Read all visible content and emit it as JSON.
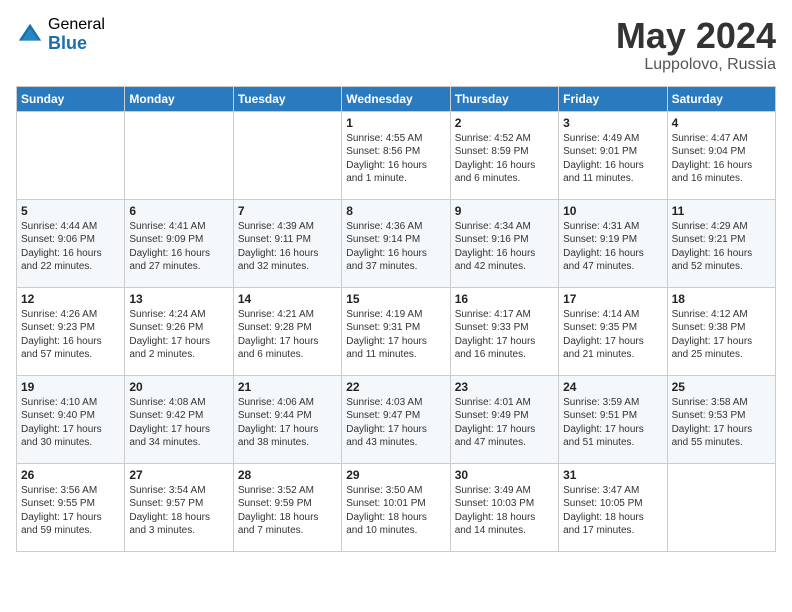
{
  "header": {
    "logo_general": "General",
    "logo_blue": "Blue",
    "month_year": "May 2024",
    "location": "Luppolovo, Russia"
  },
  "days_of_week": [
    "Sunday",
    "Monday",
    "Tuesday",
    "Wednesday",
    "Thursday",
    "Friday",
    "Saturday"
  ],
  "weeks": [
    [
      {
        "day": "",
        "sunrise": "",
        "sunset": "",
        "daylight": ""
      },
      {
        "day": "",
        "sunrise": "",
        "sunset": "",
        "daylight": ""
      },
      {
        "day": "",
        "sunrise": "",
        "sunset": "",
        "daylight": ""
      },
      {
        "day": "1",
        "sunrise": "Sunrise: 4:55 AM",
        "sunset": "Sunset: 8:56 PM",
        "daylight": "Daylight: 16 hours and 1 minute."
      },
      {
        "day": "2",
        "sunrise": "Sunrise: 4:52 AM",
        "sunset": "Sunset: 8:59 PM",
        "daylight": "Daylight: 16 hours and 6 minutes."
      },
      {
        "day": "3",
        "sunrise": "Sunrise: 4:49 AM",
        "sunset": "Sunset: 9:01 PM",
        "daylight": "Daylight: 16 hours and 11 minutes."
      },
      {
        "day": "4",
        "sunrise": "Sunrise: 4:47 AM",
        "sunset": "Sunset: 9:04 PM",
        "daylight": "Daylight: 16 hours and 16 minutes."
      }
    ],
    [
      {
        "day": "5",
        "sunrise": "Sunrise: 4:44 AM",
        "sunset": "Sunset: 9:06 PM",
        "daylight": "Daylight: 16 hours and 22 minutes."
      },
      {
        "day": "6",
        "sunrise": "Sunrise: 4:41 AM",
        "sunset": "Sunset: 9:09 PM",
        "daylight": "Daylight: 16 hours and 27 minutes."
      },
      {
        "day": "7",
        "sunrise": "Sunrise: 4:39 AM",
        "sunset": "Sunset: 9:11 PM",
        "daylight": "Daylight: 16 hours and 32 minutes."
      },
      {
        "day": "8",
        "sunrise": "Sunrise: 4:36 AM",
        "sunset": "Sunset: 9:14 PM",
        "daylight": "Daylight: 16 hours and 37 minutes."
      },
      {
        "day": "9",
        "sunrise": "Sunrise: 4:34 AM",
        "sunset": "Sunset: 9:16 PM",
        "daylight": "Daylight: 16 hours and 42 minutes."
      },
      {
        "day": "10",
        "sunrise": "Sunrise: 4:31 AM",
        "sunset": "Sunset: 9:19 PM",
        "daylight": "Daylight: 16 hours and 47 minutes."
      },
      {
        "day": "11",
        "sunrise": "Sunrise: 4:29 AM",
        "sunset": "Sunset: 9:21 PM",
        "daylight": "Daylight: 16 hours and 52 minutes."
      }
    ],
    [
      {
        "day": "12",
        "sunrise": "Sunrise: 4:26 AM",
        "sunset": "Sunset: 9:23 PM",
        "daylight": "Daylight: 16 hours and 57 minutes."
      },
      {
        "day": "13",
        "sunrise": "Sunrise: 4:24 AM",
        "sunset": "Sunset: 9:26 PM",
        "daylight": "Daylight: 17 hours and 2 minutes."
      },
      {
        "day": "14",
        "sunrise": "Sunrise: 4:21 AM",
        "sunset": "Sunset: 9:28 PM",
        "daylight": "Daylight: 17 hours and 6 minutes."
      },
      {
        "day": "15",
        "sunrise": "Sunrise: 4:19 AM",
        "sunset": "Sunset: 9:31 PM",
        "daylight": "Daylight: 17 hours and 11 minutes."
      },
      {
        "day": "16",
        "sunrise": "Sunrise: 4:17 AM",
        "sunset": "Sunset: 9:33 PM",
        "daylight": "Daylight: 17 hours and 16 minutes."
      },
      {
        "day": "17",
        "sunrise": "Sunrise: 4:14 AM",
        "sunset": "Sunset: 9:35 PM",
        "daylight": "Daylight: 17 hours and 21 minutes."
      },
      {
        "day": "18",
        "sunrise": "Sunrise: 4:12 AM",
        "sunset": "Sunset: 9:38 PM",
        "daylight": "Daylight: 17 hours and 25 minutes."
      }
    ],
    [
      {
        "day": "19",
        "sunrise": "Sunrise: 4:10 AM",
        "sunset": "Sunset: 9:40 PM",
        "daylight": "Daylight: 17 hours and 30 minutes."
      },
      {
        "day": "20",
        "sunrise": "Sunrise: 4:08 AM",
        "sunset": "Sunset: 9:42 PM",
        "daylight": "Daylight: 17 hours and 34 minutes."
      },
      {
        "day": "21",
        "sunrise": "Sunrise: 4:06 AM",
        "sunset": "Sunset: 9:44 PM",
        "daylight": "Daylight: 17 hours and 38 minutes."
      },
      {
        "day": "22",
        "sunrise": "Sunrise: 4:03 AM",
        "sunset": "Sunset: 9:47 PM",
        "daylight": "Daylight: 17 hours and 43 minutes."
      },
      {
        "day": "23",
        "sunrise": "Sunrise: 4:01 AM",
        "sunset": "Sunset: 9:49 PM",
        "daylight": "Daylight: 17 hours and 47 minutes."
      },
      {
        "day": "24",
        "sunrise": "Sunrise: 3:59 AM",
        "sunset": "Sunset: 9:51 PM",
        "daylight": "Daylight: 17 hours and 51 minutes."
      },
      {
        "day": "25",
        "sunrise": "Sunrise: 3:58 AM",
        "sunset": "Sunset: 9:53 PM",
        "daylight": "Daylight: 17 hours and 55 minutes."
      }
    ],
    [
      {
        "day": "26",
        "sunrise": "Sunrise: 3:56 AM",
        "sunset": "Sunset: 9:55 PM",
        "daylight": "Daylight: 17 hours and 59 minutes."
      },
      {
        "day": "27",
        "sunrise": "Sunrise: 3:54 AM",
        "sunset": "Sunset: 9:57 PM",
        "daylight": "Daylight: 18 hours and 3 minutes."
      },
      {
        "day": "28",
        "sunrise": "Sunrise: 3:52 AM",
        "sunset": "Sunset: 9:59 PM",
        "daylight": "Daylight: 18 hours and 7 minutes."
      },
      {
        "day": "29",
        "sunrise": "Sunrise: 3:50 AM",
        "sunset": "Sunset: 10:01 PM",
        "daylight": "Daylight: 18 hours and 10 minutes."
      },
      {
        "day": "30",
        "sunrise": "Sunrise: 3:49 AM",
        "sunset": "Sunset: 10:03 PM",
        "daylight": "Daylight: 18 hours and 14 minutes."
      },
      {
        "day": "31",
        "sunrise": "Sunrise: 3:47 AM",
        "sunset": "Sunset: 10:05 PM",
        "daylight": "Daylight: 18 hours and 17 minutes."
      },
      {
        "day": "",
        "sunrise": "",
        "sunset": "",
        "daylight": ""
      }
    ]
  ]
}
